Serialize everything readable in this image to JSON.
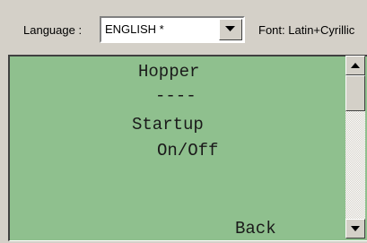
{
  "toolbar": {
    "language_label": "Language :",
    "language_value": "ENGLISH *",
    "font_label": "Font: Latin+Cyrillic"
  },
  "screen": {
    "lines": [
      "Hopper",
      "----",
      "Startup",
      "On/Off",
      "Back"
    ]
  },
  "colors": {
    "lcd_background": "#8fc08e",
    "window_background": "#d4d0c8"
  },
  "icons": {
    "dropdown": "chevron-down-icon",
    "scroll_up": "arrow-up-icon",
    "scroll_down": "arrow-down-icon"
  }
}
